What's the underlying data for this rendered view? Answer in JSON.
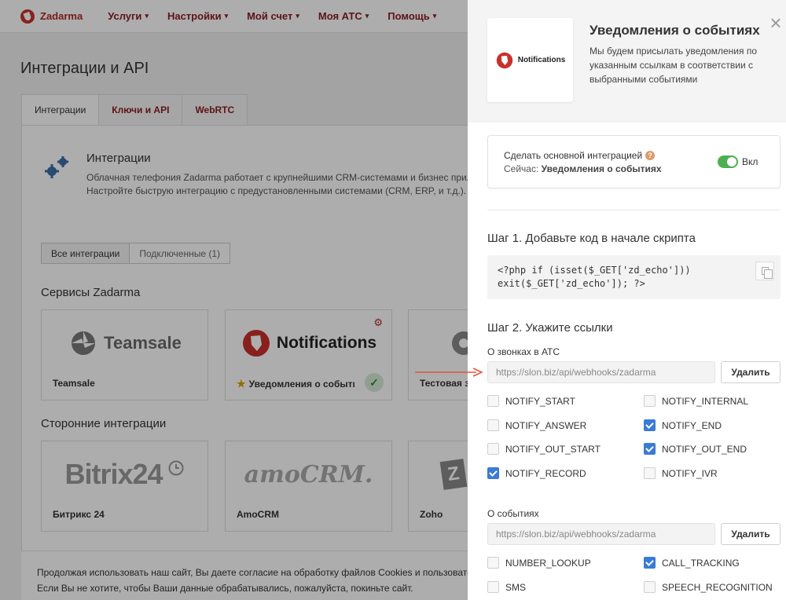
{
  "topnav": {
    "brand": "Zadarma",
    "items": [
      {
        "label": "Услуги"
      },
      {
        "label": "Настройки"
      },
      {
        "label": "Мой счет"
      },
      {
        "label": "Моя АТС"
      },
      {
        "label": "Помощь"
      }
    ]
  },
  "page": {
    "title": "Интеграции и API",
    "tabs": [
      {
        "label": "Интеграции"
      },
      {
        "label": "Ключи и API"
      },
      {
        "label": "WebRTC"
      }
    ],
    "intro": {
      "title": "Интеграции",
      "line1": "Облачная телефония Zadarma работает с крупнейшими CRM-системами и бизнес прил",
      "line2": "Настройте быструю интеграцию с предустановленными системами (CRM, ERP, и т.д.)."
    },
    "filters": {
      "all": "Все интеграции",
      "connected": "Подключенные (1)"
    },
    "services_title": "Сервисы Zadarma",
    "services": [
      {
        "logo_text": "Teamsale",
        "label": "Teamsale"
      },
      {
        "logo_text": "Notifications",
        "label": "Уведомления о событиях"
      },
      {
        "logo_text": "",
        "label": "Тестовая за"
      }
    ],
    "third_party_title": "Сторонние интеграции",
    "third_party": [
      {
        "logo_text": "Bitrix24",
        "label": "Битрикс 24"
      },
      {
        "logo_text": "amoCRM.",
        "label": "AmoCRM"
      },
      {
        "logo_text": "Z",
        "label": "Zoho"
      }
    ],
    "cookie": {
      "line1": "Продолжая использовать наш сайт, Вы даете согласие на обработку файлов Cookies и пользовате",
      "line2": "Если Вы не хотите, чтобы Ваши данные обрабатывались, пожалуйста, покиньте сайт."
    }
  },
  "drawer": {
    "logo_text": "Notifications",
    "title": "Уведомления о событиях",
    "description": "Мы будем присылать уведомления по указанным ссылкам в соответствии с выбранными событиями",
    "close_symbol": "×",
    "main_integration": {
      "label": "Сделать основной интеграцией",
      "help_symbol": "?",
      "current_prefix": "Сейчас:",
      "current_value": "Уведомления о событиях",
      "toggle_label": "Вкл",
      "toggle_on": true
    },
    "step1": {
      "title": "Шаг 1. Добавьте код в начале скрипта",
      "code_line1": "<?php if (isset($_GET['zd_echo']))",
      "code_line2": "exit($_GET['zd_echo']); ?>"
    },
    "step2": {
      "title": "Шаг 2. Укажите ссылки",
      "calls": {
        "label": "О звонках в АТС",
        "url": "https://slon.biz/api/webhooks/zadarma",
        "delete_label": "Удалить",
        "options": [
          {
            "name": "NOTIFY_START",
            "checked": false
          },
          {
            "name": "NOTIFY_INTERNAL",
            "checked": false
          },
          {
            "name": "NOTIFY_ANSWER",
            "checked": false
          },
          {
            "name": "NOTIFY_END",
            "checked": true
          },
          {
            "name": "NOTIFY_OUT_START",
            "checked": false
          },
          {
            "name": "NOTIFY_OUT_END",
            "checked": true
          },
          {
            "name": "NOTIFY_RECORD",
            "checked": true
          },
          {
            "name": "NOTIFY_IVR",
            "checked": false
          }
        ]
      },
      "events": {
        "label": "О событиях",
        "url": "https://slon.biz/api/webhooks/zadarma",
        "delete_label": "Удалить",
        "options": [
          {
            "name": "NUMBER_LOOKUP",
            "checked": false
          },
          {
            "name": "CALL_TRACKING",
            "checked": true
          },
          {
            "name": "SMS",
            "checked": false
          },
          {
            "name": "SPEECH_RECOGNITION",
            "checked": false
          }
        ]
      }
    }
  },
  "colors": {
    "brand": "#b0282a",
    "toggle_on": "#4caf50",
    "checkbox_on": "#3a7bd5",
    "arrow": "#e0553a"
  }
}
